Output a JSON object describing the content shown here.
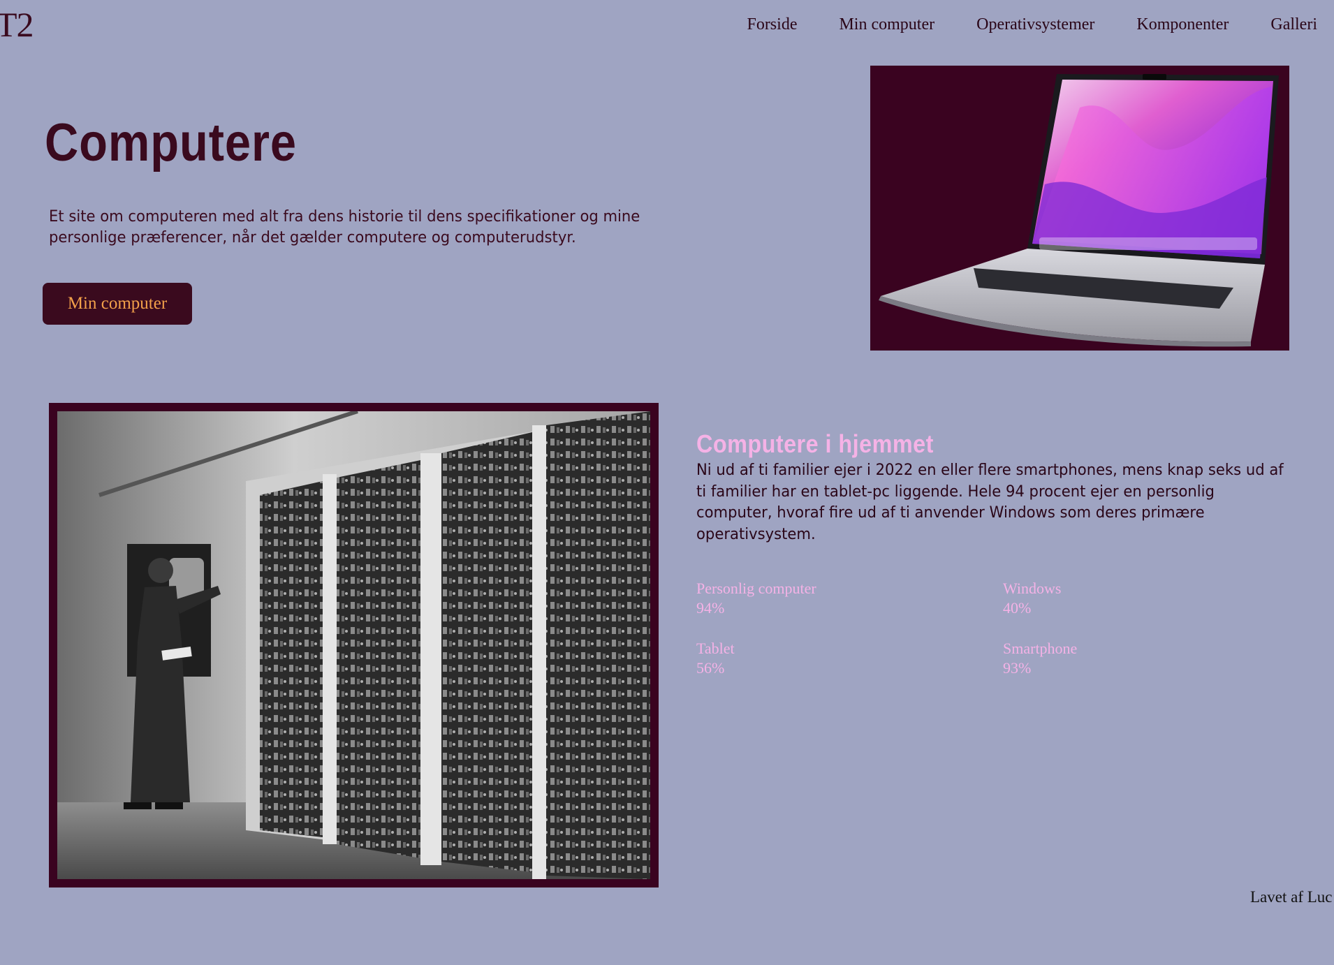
{
  "header": {
    "logo": "T2",
    "nav": [
      "Forside",
      "Min computer",
      "Operativsystemer",
      "Komponenter",
      "Galleri"
    ]
  },
  "hero": {
    "title": "Computere",
    "text": "Et site om computeren med alt fra dens historie til dens specifikationer og mine personlige præferencer, når det gælder computere og computerudstyr.",
    "button_label": "Min computer"
  },
  "home_section": {
    "title": "Computere i hjemmet",
    "text": "Ni ud af ti familier ejer i 2022 en eller flere smartphones, mens knap seks ud af ti familier har en tablet-pc liggende. Hele 94 procent ejer en personlig computer, hvoraf fire ud af ti anvender Windows som deres primære operativsystem.",
    "stats": [
      {
        "label": "Personlig computer",
        "value": "94%"
      },
      {
        "label": "Windows",
        "value": "40%"
      },
      {
        "label": "Tablet",
        "value": "56%"
      },
      {
        "label": "Smartphone",
        "value": "93%"
      }
    ]
  },
  "footer": {
    "text": "Lavet af Luc"
  },
  "colors": {
    "background": "#9fa4c2",
    "primary": "#3a0a1e",
    "accent_pink": "#f5b2e6",
    "button_text": "#f2a04a"
  },
  "images": {
    "laptop": "laptop-photo",
    "historic_computer": "historic-computer-photo"
  }
}
